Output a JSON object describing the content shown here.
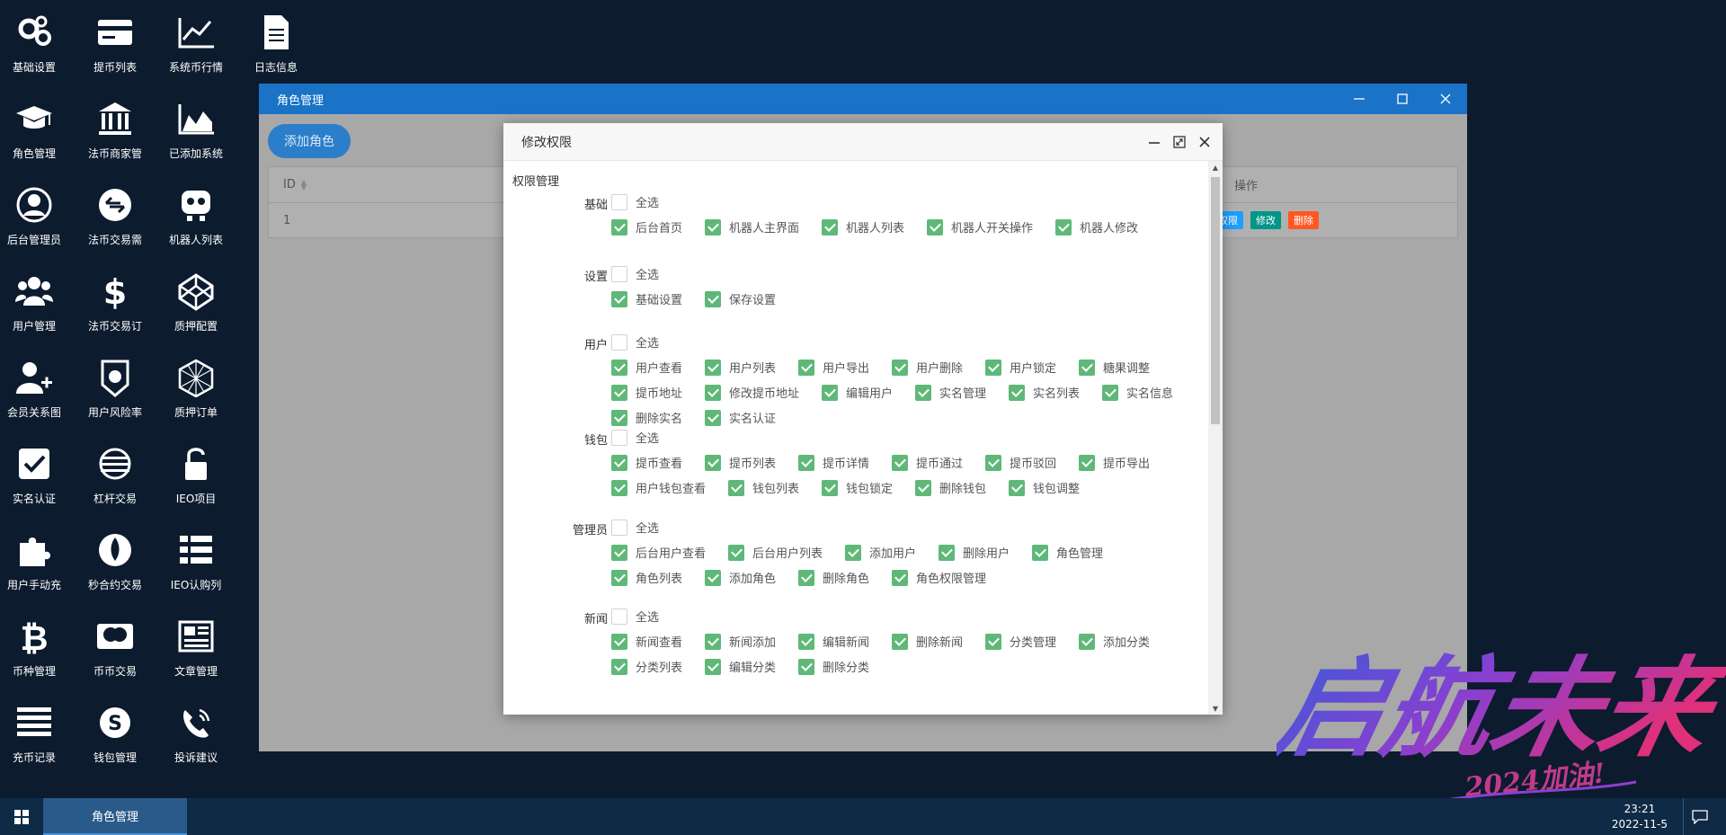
{
  "desktop": {
    "icons": [
      {
        "label": "基础设置",
        "icon": "gears-icon"
      },
      {
        "label": "提币列表",
        "icon": "card-icon"
      },
      {
        "label": "系统币行情",
        "icon": "line-chart-icon"
      },
      {
        "label": "日志信息",
        "icon": "document-icon"
      },
      {
        "label": "角色管理",
        "icon": "graduation-cap-icon"
      },
      {
        "label": "法币商家管",
        "icon": "bank-icon"
      },
      {
        "label": "已添加系统",
        "icon": "area-chart-icon"
      },
      {
        "label": "后台管理员",
        "icon": "user-circle-icon"
      },
      {
        "label": "法币交易需",
        "icon": "exchange-icon"
      },
      {
        "label": "机器人列表",
        "icon": "robot-icon"
      },
      {
        "label": "用户管理",
        "icon": "users-icon"
      },
      {
        "label": "法币交易订",
        "icon": "dollar-icon"
      },
      {
        "label": "质押配置",
        "icon": "codepen-icon"
      },
      {
        "label": "会员关系图",
        "icon": "user-plus-icon"
      },
      {
        "label": "用户风险率",
        "icon": "shield-icon"
      },
      {
        "label": "质押订单",
        "icon": "hexagon-icon"
      },
      {
        "label": "实名认证",
        "icon": "check-square-icon"
      },
      {
        "label": "杠杆交易",
        "icon": "lever-icon"
      },
      {
        "label": "IEO项目",
        "icon": "unlock-icon"
      },
      {
        "label": "用户手动充",
        "icon": "puzzle-icon"
      },
      {
        "label": "秒合约交易",
        "icon": "rebel-icon"
      },
      {
        "label": "IEO认购列",
        "icon": "list-icon"
      },
      {
        "label": "币种管理",
        "icon": "bitcoin-icon"
      },
      {
        "label": "币币交易",
        "icon": "mastercard-icon"
      },
      {
        "label": "文章管理",
        "icon": "newspaper-icon"
      },
      {
        "label": "充币记录",
        "icon": "bars-icon"
      },
      {
        "label": "钱包管理",
        "icon": "skype-icon"
      },
      {
        "label": "投诉建议",
        "icon": "phone-icon"
      }
    ]
  },
  "window": {
    "title": "角色管理",
    "add_button": "添加角色",
    "table": {
      "headers": {
        "id": "ID",
        "ops": "操作"
      },
      "rows": [
        {
          "id": "1",
          "ops": [
            "权限",
            "修改",
            "删除"
          ]
        }
      ]
    }
  },
  "modal": {
    "title": "修改权限",
    "section_title": "权限管理",
    "select_all_label": "全选",
    "groups": [
      {
        "label": "基础",
        "items": [
          "后台首页",
          "机器人主界面",
          "机器人列表",
          "机器人开关操作",
          "机器人修改"
        ]
      },
      {
        "label": "设置",
        "items": [
          "基础设置",
          "保存设置"
        ]
      },
      {
        "label": "用户",
        "items": [
          "用户查看",
          "用户列表",
          "用户导出",
          "用户删除",
          "用户锁定",
          "糖果调整",
          "提币地址",
          "修改提币地址",
          "编辑用户",
          "实名管理",
          "实名列表",
          "实名信息",
          "删除实名",
          "实名认证"
        ]
      },
      {
        "label": "钱包",
        "items": [
          "提币查看",
          "提币列表",
          "提币详情",
          "提币通过",
          "提币驳回",
          "提币导出",
          "用户钱包查看",
          "钱包列表",
          "钱包锁定",
          "删除钱包",
          "钱包调整"
        ]
      },
      {
        "label": "管理员",
        "items": [
          "后台用户查看",
          "后台用户列表",
          "添加用户",
          "删除用户",
          "角色管理",
          "角色列表",
          "添加角色",
          "删除角色",
          "角色权限管理"
        ]
      },
      {
        "label": "新闻",
        "items": [
          "新闻查看",
          "新闻添加",
          "编辑新闻",
          "删除新闻",
          "分类管理",
          "添加分类",
          "分类列表",
          "编辑分类",
          "删除分类"
        ]
      }
    ]
  },
  "taskbar": {
    "active_task": "角色管理",
    "time": "23:21",
    "date": "2022-11-5"
  },
  "watermark": {
    "main": "启航未来",
    "sub": "2024加油!"
  },
  "colors": {
    "desktop_bg": "#0c1b2e",
    "window_title_bar": "#1a73c6",
    "checkbox_checked": "#5fb878",
    "op_perm": "#1e9fff",
    "op_edit": "#009688",
    "op_delete": "#ff5722"
  }
}
